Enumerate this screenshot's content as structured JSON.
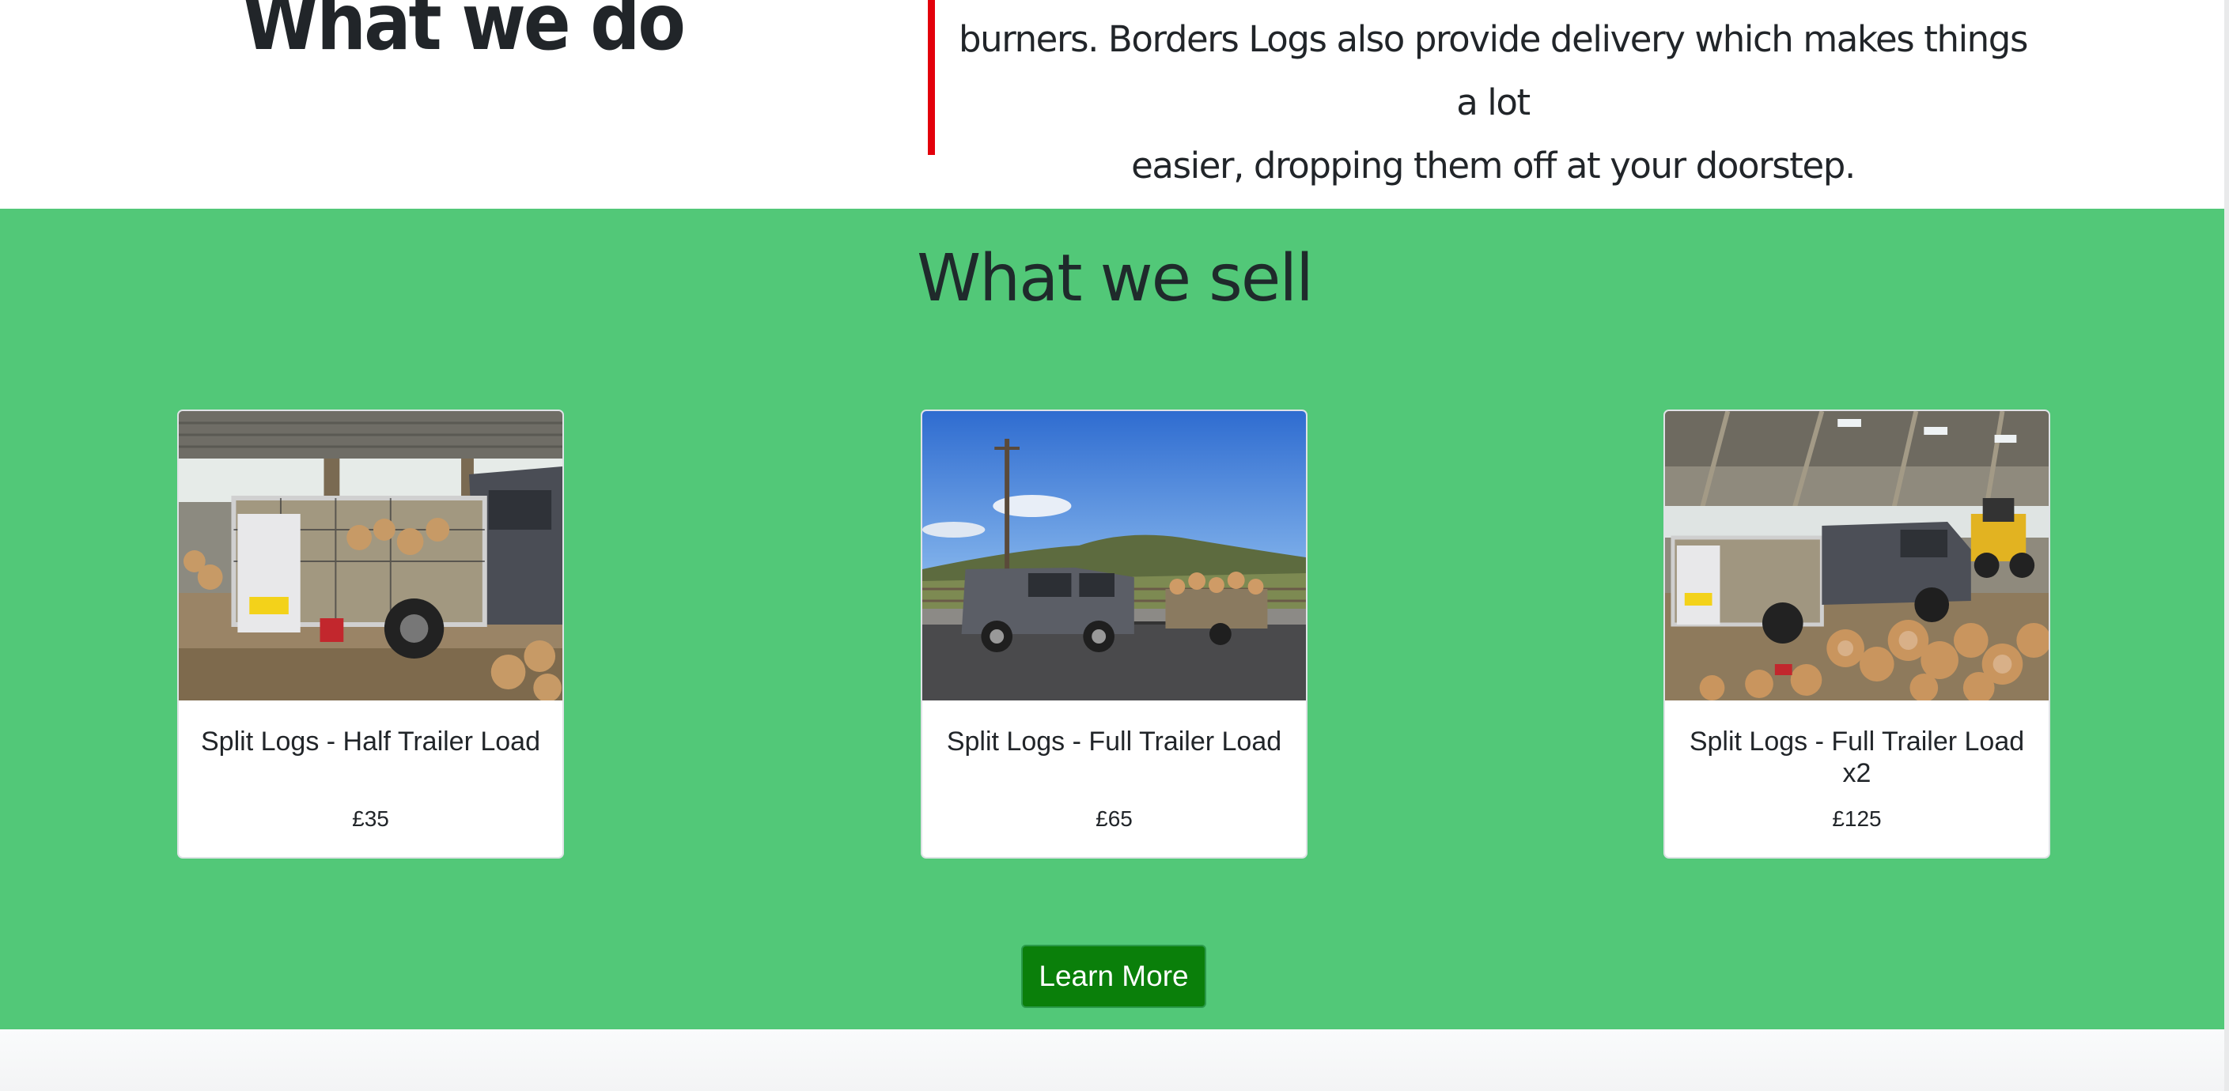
{
  "about": {
    "title": "What we do",
    "text_line1": "burners. Borders Logs also provide delivery which makes things a lot",
    "text_line2": "easier, dropping them off at your doorstep."
  },
  "shop": {
    "title": "What we sell",
    "products": [
      {
        "title": "Split Logs - Half Trailer Load",
        "price": "£35",
        "image": "trailer-with-logs-in-barn"
      },
      {
        "title": "Split Logs - Full Trailer Load",
        "price": "£65",
        "image": "van-towing-trailer-outdoors"
      },
      {
        "title": "Split Logs - Full Trailer Load x2",
        "price": "£125",
        "image": "van-trailer-and-log-pile-in-barn"
      }
    ],
    "button_label": "Learn More"
  },
  "colors": {
    "section_green": "#52c878",
    "divider_red": "#e3000b",
    "button_green": "#0a7f0a"
  }
}
